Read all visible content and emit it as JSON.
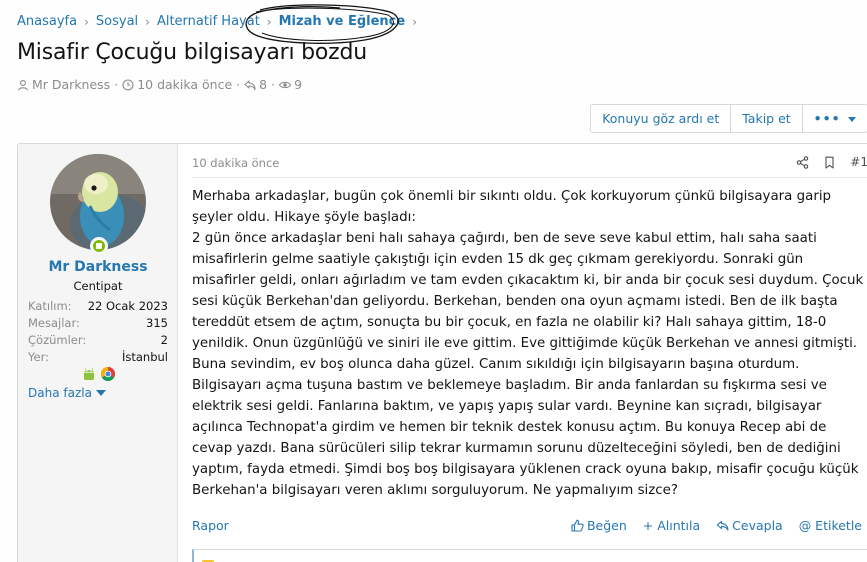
{
  "breadcrumb": {
    "items": [
      "Anasayfa",
      "Sosyal",
      "Alternatif Hayat",
      "Mizah ve Eğlence"
    ]
  },
  "thread": {
    "title": "Misafir Çocuğu bilgisayarı bozdu",
    "author": "Mr Darkness",
    "time": "10 dakika önce",
    "replies": "8",
    "views": "9"
  },
  "thread_actions": {
    "ignore": "Konuyu göz ardı et",
    "follow": "Takip et",
    "more": "•••"
  },
  "user": {
    "name": "Mr Darkness",
    "title": "Centipat",
    "stats": [
      {
        "label": "Katılım:",
        "value": "22 Ocak 2023"
      },
      {
        "label": "Mesajlar:",
        "value": "315"
      },
      {
        "label": "Çözümler:",
        "value": "2"
      },
      {
        "label": "Yer:",
        "value": "İstanbul"
      }
    ],
    "more": "Daha fazla"
  },
  "post": {
    "time": "10 dakika önce",
    "number": "#1",
    "paragraphs": [
      "Merhaba arkadaşlar, bugün çok önemli bir sıkıntı oldu. Çok korkuyorum çünkü bilgisayara garip şeyler oldu. Hikaye şöyle başladı:",
      "2 gün önce arkadaşlar beni halı sahaya çağırdı, ben de seve seve kabul ettim, halı saha saati misafirlerin gelme saatiyle çakıştığı için evden 15 dk geç çıkmam gerekiyordu. Sonraki gün misafirler geldi, onları ağırladım ve tam evden çıkacaktım ki, bir anda bir çocuk sesi duydum. Çocuk sesi küçük Berkehan'dan geliyordu. Berkehan, benden ona oyun açmamı istedi. Ben de ilk başta tereddüt etsem de açtım, sonuçta bu bir çocuk, en fazla ne olabilir ki? Halı sahaya gittim, 18-0 yenildik. Onun üzgünlüğü ve siniri ile eve gittim. Eve gittiğimde küçük Berkehan ve annesi gitmişti. Buna sevindim, ev boş olunca daha güzel. Canım sıkıldığı için bilgisayarın başına oturdum. Bilgisayarı açma tuşuna bastım ve beklemeye başladım. Bir anda fanlardan su fışkırma sesi ve elektrik sesi geldi. Fanlarına baktım, ve yapış yapış sular vardı. Beynine kan sıçradı, bilgisayar açılınca Technopat'a girdim ve hemen bir teknik destek konusu açtım. Bu konuya Recep abi de cevap yazdı. Bana sürücüleri silip tekrar kurmamın sorunu düzelteceğini söyledi, ben de dediğini yaptım, fayda etmedi. Şimdi boş boş bilgisayara yüklenen crack oyuna bakıp, misafir çocuğu küçük Berkehan'a bilgisayarı veren aklımı sorguluyorum. Ne yapmalıyım sizce?"
    ]
  },
  "post_actions": {
    "report": "Rapor",
    "like": "Beğen",
    "quote": "+ Alıntıla",
    "reply": "Cevapla",
    "tag": "@ Etiketle"
  },
  "colors": {
    "link": "#2577b1",
    "muted": "#8c8c8c",
    "online": "#7fb900"
  }
}
